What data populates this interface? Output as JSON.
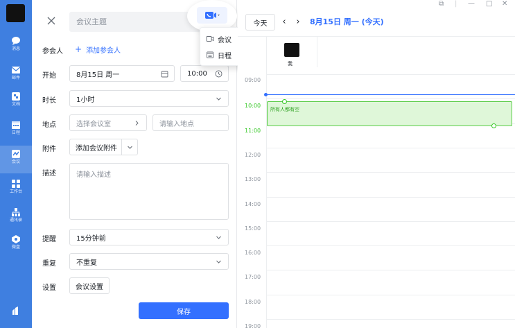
{
  "sidebar": {
    "items": [
      {
        "label": "消息",
        "icon": "chat-icon"
      },
      {
        "label": "邮件",
        "icon": "mail-icon"
      },
      {
        "label": "文档",
        "icon": "doc-icon"
      },
      {
        "label": "日程",
        "icon": "calendar-icon"
      },
      {
        "label": "会议",
        "icon": "meeting-icon"
      },
      {
        "label": "工作台",
        "icon": "workbench-icon"
      },
      {
        "label": "通讯录",
        "icon": "contacts-icon"
      },
      {
        "label": "微盘",
        "icon": "drive-icon"
      }
    ],
    "active": "会议"
  },
  "form": {
    "title_placeholder": "会议主题",
    "attendees_label": "参会人",
    "add_attendee": "添加参会人",
    "start_label": "开始",
    "start_date": "8月15日 周一",
    "start_time": "10:00",
    "duration_label": "时长",
    "duration_value": "1小时",
    "location_label": "地点",
    "room_placeholder": "选择会议室",
    "location_placeholder": "请输入地点",
    "attachment_label": "附件",
    "attachment_button": "添加会议附件",
    "description_label": "描述",
    "description_placeholder": "请输入描述",
    "reminder_label": "提醒",
    "reminder_value": "15分钟前",
    "repeat_label": "重复",
    "repeat_value": "不重复",
    "settings_label": "设置",
    "settings_button": "会议设置",
    "save_button": "保存"
  },
  "type_menu": {
    "items": [
      "会议",
      "日程"
    ]
  },
  "calendar": {
    "today_button": "今天",
    "date_title": "8月15日 周一 (今天)",
    "attendee_name": "我",
    "hours": [
      "09:00",
      "10:00",
      "11:00",
      "12:00",
      "13:00",
      "14:00",
      "15:00",
      "16:00",
      "17:00",
      "18:00",
      "19:00"
    ],
    "event_text": "所有人都有空",
    "accent_color": "#3370ff",
    "free_color": "#34c724"
  }
}
